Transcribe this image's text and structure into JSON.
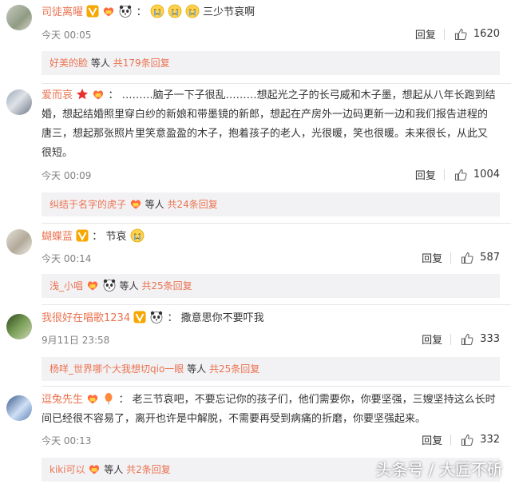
{
  "comments": [
    {
      "user": "司徒离曜",
      "separator": "：",
      "text": "三少节哀啊",
      "time": "今天 00:05",
      "reply_label": "回复",
      "likes": "1620",
      "sub_user": "好美的脸",
      "sub_text": "等人",
      "sub_count": "共179条回复"
    },
    {
      "user": "爱而哀",
      "separator": "：",
      "text_line1": "………脑子一下子很乱………想起光之子的长弓威和木子墨，想起从八年长跑到结",
      "text_line2": "婚，想起结婚照里穿白纱的新娘和带墨镜的新郎，想起在产房外一边码更新一边和我们报告进程的",
      "text_line3": "唐三，想起那张照片里笑意盈盈的木子，抱着孩子的老人，光很暖，笑也很暖。未来很长，从此又",
      "text_line4": "很短。",
      "time": "今天 00:09",
      "reply_label": "回复",
      "likes": "1004",
      "sub_user": "纠结于名字的虎子",
      "sub_text": "等人",
      "sub_count": "共24条回复"
    },
    {
      "user": "蝴蝶蓝",
      "separator": "：",
      "text": "节哀",
      "time": "今天 00:14",
      "reply_label": "回复",
      "likes": "587",
      "sub_user": "浅_小唱",
      "sub_text": "等人",
      "sub_count": "共25条回复"
    },
    {
      "user": "我很好在唱歌1234",
      "separator": "：",
      "text": "撒意思你不要吓我",
      "time": "9月11日 23:58",
      "reply_label": "回复",
      "likes": "333",
      "sub_user": "杨咩_世界哪个大我想切qio一眼",
      "sub_text": "等人",
      "sub_count": "共25条回复"
    },
    {
      "user": "逗兔先生",
      "separator": "：",
      "text_line1": "老三节哀吧，不要忘记你的孩子们，他们需要你，你要坚强，三嫂坚持这么长时",
      "text_line2": "间已经很不容易了，离开也许是中解脱，不需要再受到病痛的折磨，你要坚强起来。",
      "time": "今天 00:13",
      "reply_label": "回复",
      "likes": "332",
      "sub_user": "kiki可以",
      "sub_text": "等人",
      "sub_count": "共2条回复"
    }
  ],
  "watermark": "头条号 / 大匠不斫"
}
